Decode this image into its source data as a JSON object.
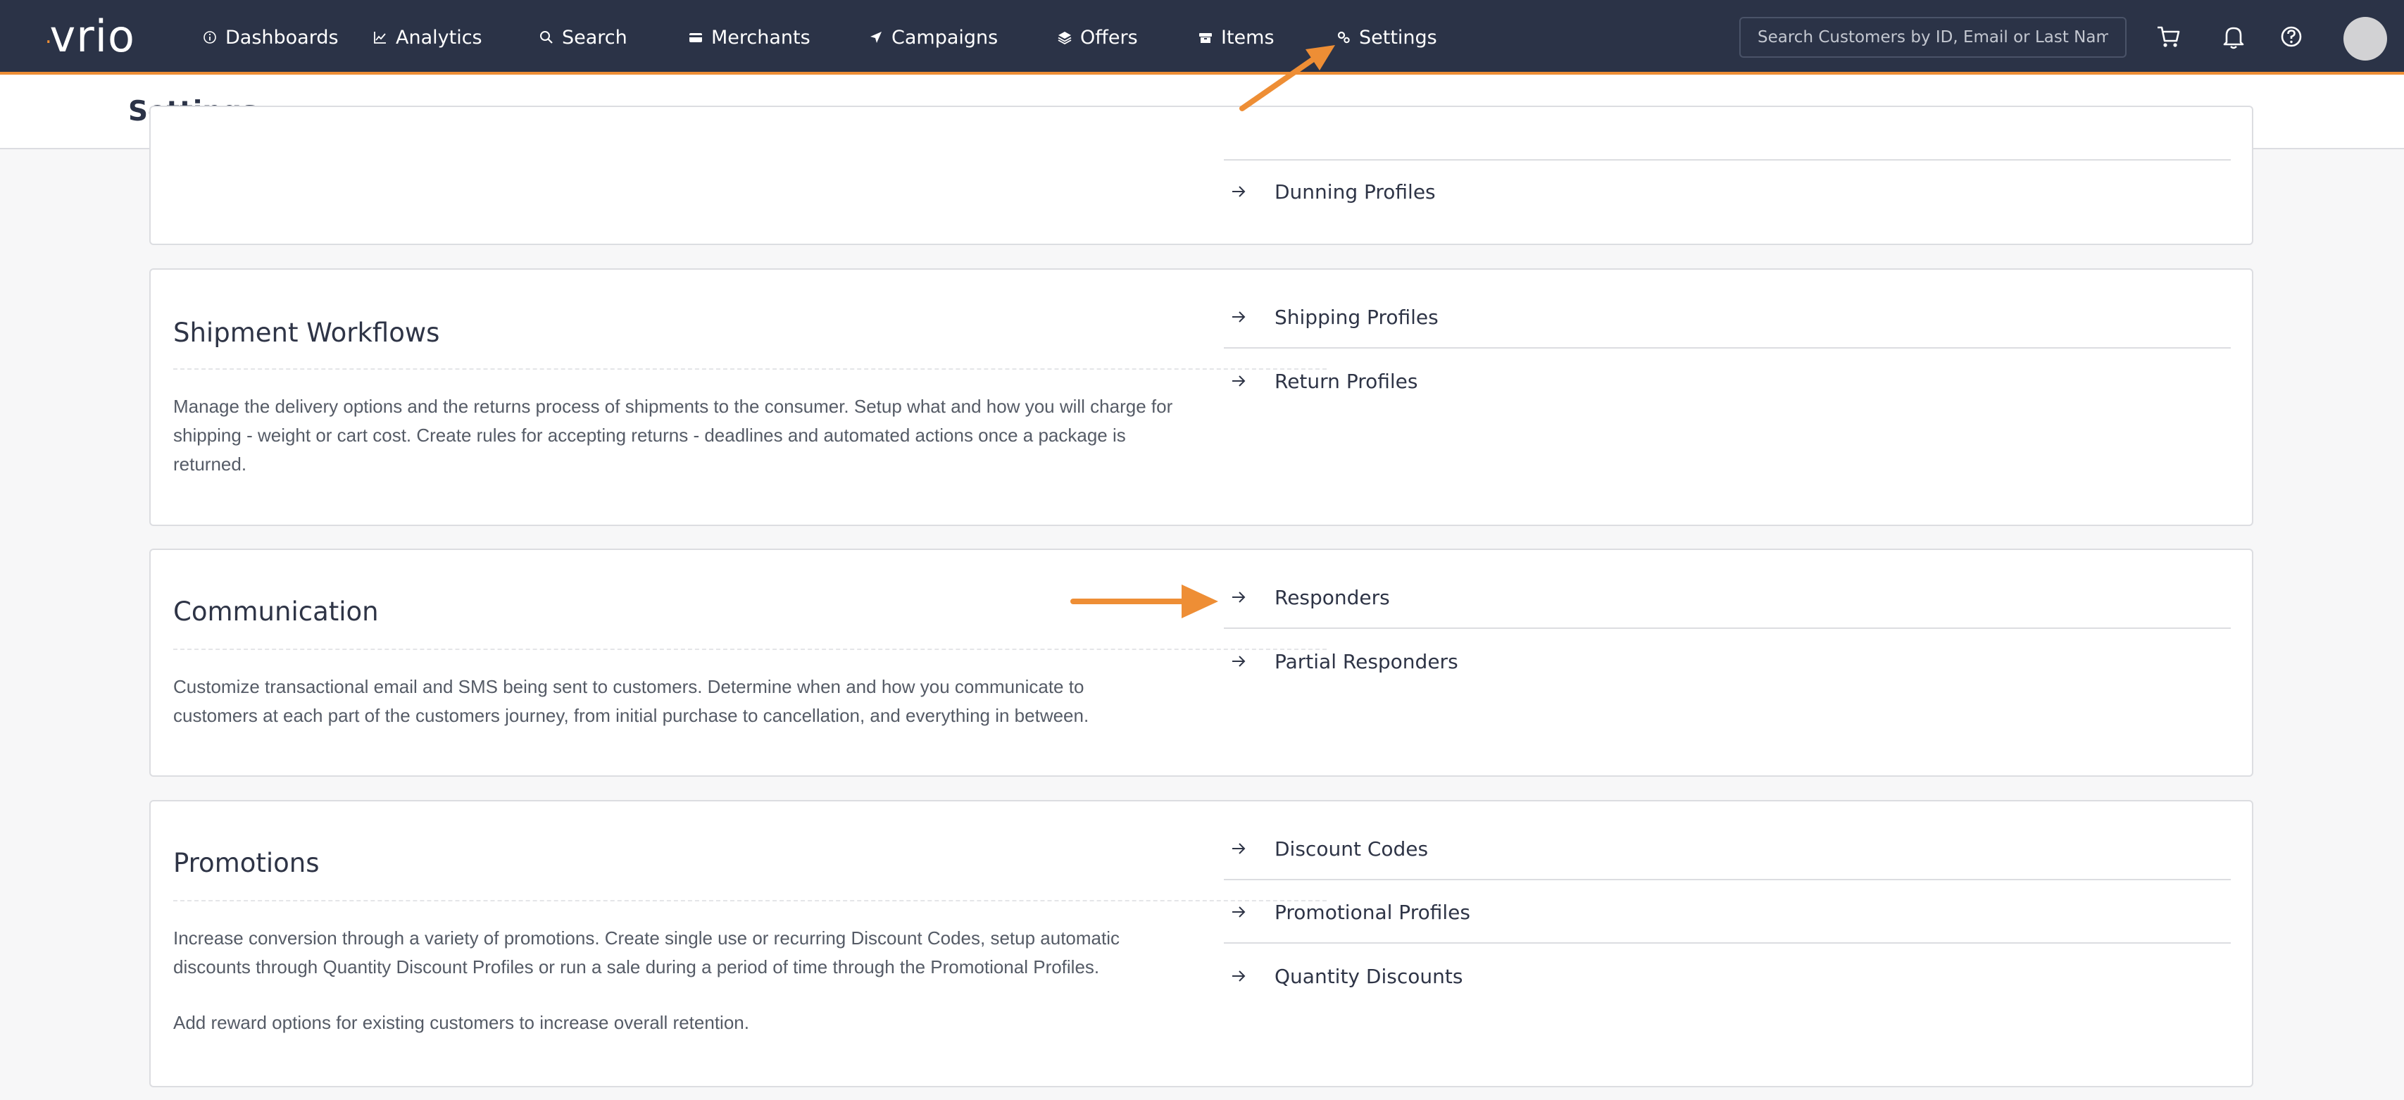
{
  "brand": {
    "logo_text": "vrio"
  },
  "nav": {
    "items": [
      {
        "label": "Dashboards",
        "icon": "info-circle-icon"
      },
      {
        "label": "Analytics",
        "icon": "line-chart-icon"
      },
      {
        "label": "Search",
        "icon": "search-icon"
      },
      {
        "label": "Merchants",
        "icon": "credit-card-icon"
      },
      {
        "label": "Campaigns",
        "icon": "send-icon"
      },
      {
        "label": "Offers",
        "icon": "layers-icon"
      },
      {
        "label": "Items",
        "icon": "box-icon"
      },
      {
        "label": "Settings",
        "icon": "gears-icon"
      }
    ],
    "active": "Settings",
    "search_placeholder": "Search Customers by ID, Email or Last Name"
  },
  "page": {
    "title": "Settings"
  },
  "colors": {
    "nav_bg": "#2b3347",
    "accent": "#ee8e35",
    "card_border": "#dcdde1"
  },
  "sections": [
    {
      "title": "",
      "links": [
        {
          "label": "Dunning Profiles"
        }
      ]
    },
    {
      "title": "Shipment Workflows",
      "description": "Manage the delivery options and the returns process of shipments to the consumer. Setup what and how you will charge for shipping - weight or cart cost. Create rules for accepting returns - deadlines and automated actions once a package is returned.",
      "links": [
        {
          "label": "Shipping Profiles"
        },
        {
          "label": "Return Profiles"
        }
      ]
    },
    {
      "title": "Communication",
      "description": "Customize transactional email and SMS being sent to customers. Determine when and how you communicate to customers at each part of the customers journey, from initial purchase to cancellation, and everything in between.",
      "links": [
        {
          "label": "Responders"
        },
        {
          "label": "Partial Responders"
        }
      ]
    },
    {
      "title": "Promotions",
      "description": "Increase conversion through a variety of promotions. Create single use or recurring Discount Codes, setup automatic discounts through Quantity Discount Profiles or run a sale during a period of time through the Promotional Profiles.",
      "description2": "Add reward options for existing customers to increase overall retention.",
      "links": [
        {
          "label": "Discount Codes"
        },
        {
          "label": "Promotional Profiles"
        },
        {
          "label": "Quantity Discounts"
        }
      ]
    }
  ]
}
